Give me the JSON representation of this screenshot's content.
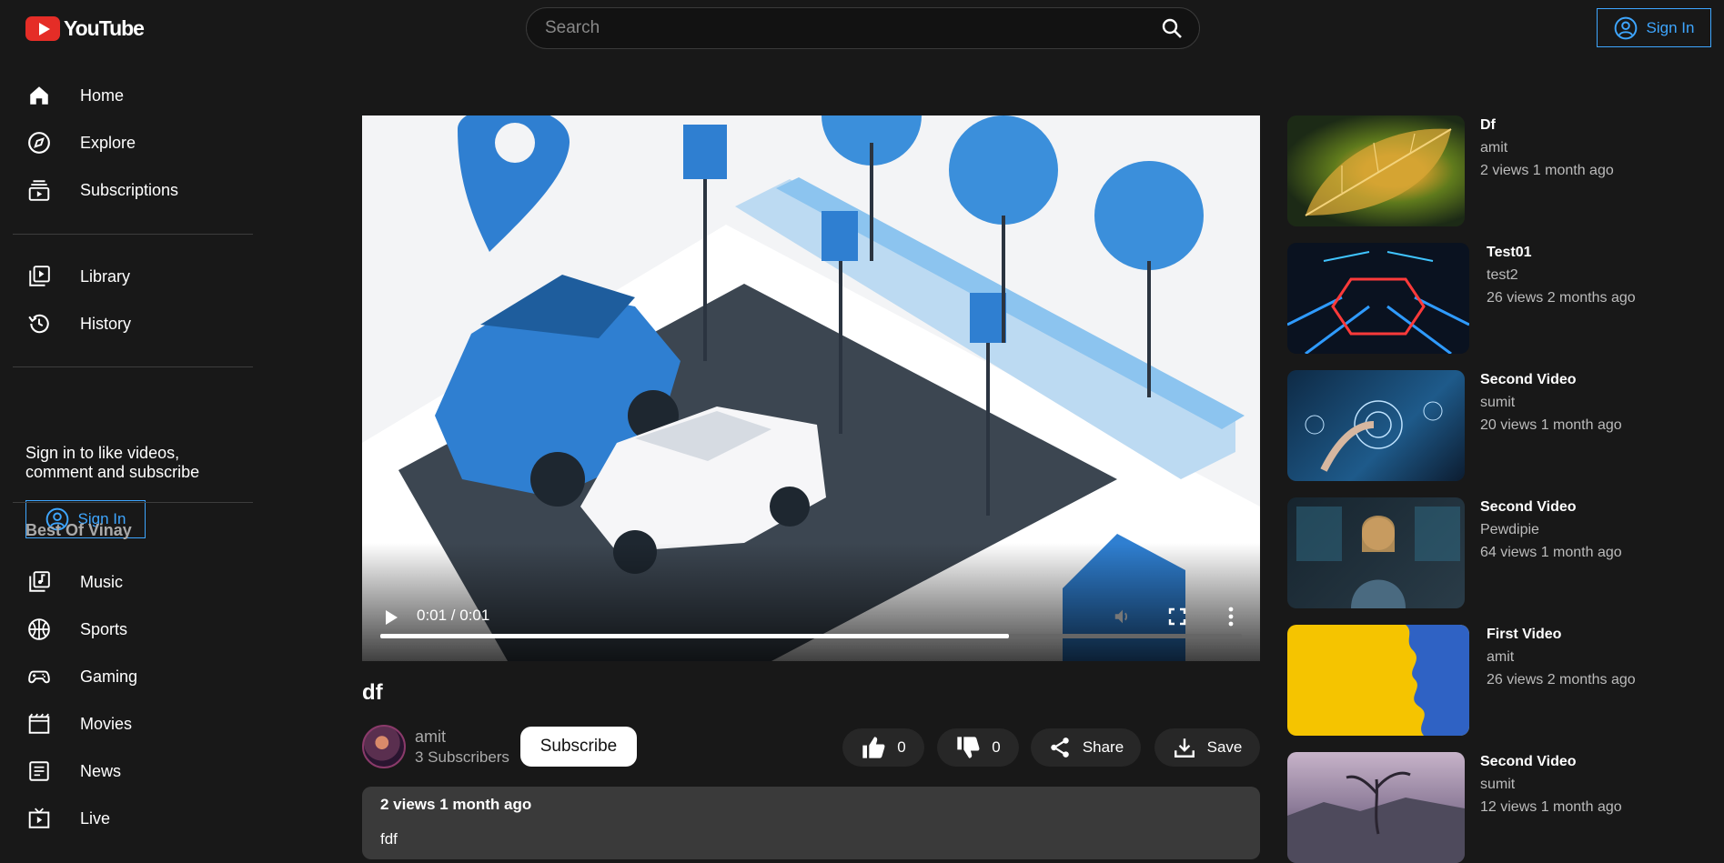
{
  "header": {
    "logo_text": "YouTube",
    "search_placeholder": "Search",
    "signin_label": "Sign In"
  },
  "sidebar": {
    "primary": [
      {
        "label": "Home",
        "icon": "home-icon"
      },
      {
        "label": "Explore",
        "icon": "compass-icon"
      },
      {
        "label": "Subscriptions",
        "icon": "subscriptions-icon"
      }
    ],
    "library": [
      {
        "label": "Library",
        "icon": "library-icon"
      },
      {
        "label": "History",
        "icon": "history-icon"
      }
    ],
    "signin_prompt": "Sign in to like videos, comment and subscribe",
    "signin_label": "Sign In",
    "section_title": "Best Of Vinay",
    "best_of": [
      {
        "label": "Music",
        "icon": "music-icon"
      },
      {
        "label": "Sports",
        "icon": "sports-icon"
      },
      {
        "label": "Gaming",
        "icon": "gaming-icon"
      },
      {
        "label": "Movies",
        "icon": "movies-icon"
      },
      {
        "label": "News",
        "icon": "news-icon"
      },
      {
        "label": "Live",
        "icon": "live-icon"
      }
    ]
  },
  "player": {
    "time": "0:01 / 0:01",
    "progress": 0.73
  },
  "video": {
    "title": "df",
    "channel": "amit",
    "subscribers": "3 Subscribers",
    "subscribe_label": "Subscribe",
    "likes": "0",
    "dislikes": "0",
    "share_label": "Share",
    "save_label": "Save",
    "meta": "2 views 1 month ago",
    "description": "fdf"
  },
  "recommendations": [
    {
      "title": "Df",
      "channel": "amit",
      "meta": "2 views 1 month ago"
    },
    {
      "title": "Test01",
      "channel": "test2",
      "meta": "26 views 2 months ago"
    },
    {
      "title": "Second Video",
      "channel": "sumit",
      "meta": "20 views 1 month ago"
    },
    {
      "title": "Second Video",
      "channel": "Pewdipie",
      "meta": "64 views 1 month ago"
    },
    {
      "title": "First Video",
      "channel": "amit",
      "meta": "26 views 2 months ago"
    },
    {
      "title": "Second Video",
      "channel": "sumit",
      "meta": "12 views 1 month ago"
    }
  ],
  "colors": {
    "background": "#181818",
    "accent": "#3ea6ff",
    "brand_red": "#e52d27"
  }
}
